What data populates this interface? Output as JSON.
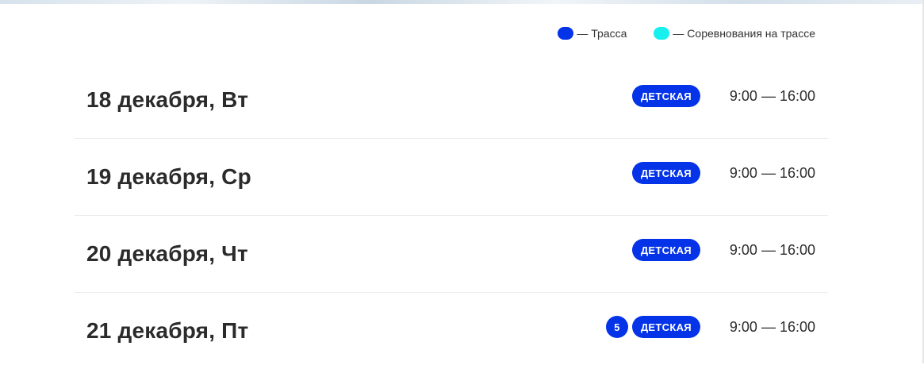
{
  "legend": {
    "items": [
      {
        "label": "— Трасса",
        "color": "#0433e8"
      },
      {
        "label": "— Соревнования на трассе",
        "color": "#18f0f0"
      }
    ]
  },
  "colors": {
    "track_badge": "#0433e8",
    "competition": "#18f0f0"
  },
  "schedule": {
    "rows": [
      {
        "date": "18 декабря, Вт",
        "count": null,
        "track": "ДЕТСКАЯ",
        "time": "9:00 — 16:00"
      },
      {
        "date": "19 декабря, Ср",
        "count": null,
        "track": "ДЕТСКАЯ",
        "time": "9:00 — 16:00"
      },
      {
        "date": "20 декабря, Чт",
        "count": null,
        "track": "ДЕТСКАЯ",
        "time": "9:00 — 16:00"
      },
      {
        "date": "21 декабря, Пт",
        "count": "5",
        "track": "ДЕТСКАЯ",
        "time": "9:00 — 16:00"
      }
    ]
  }
}
